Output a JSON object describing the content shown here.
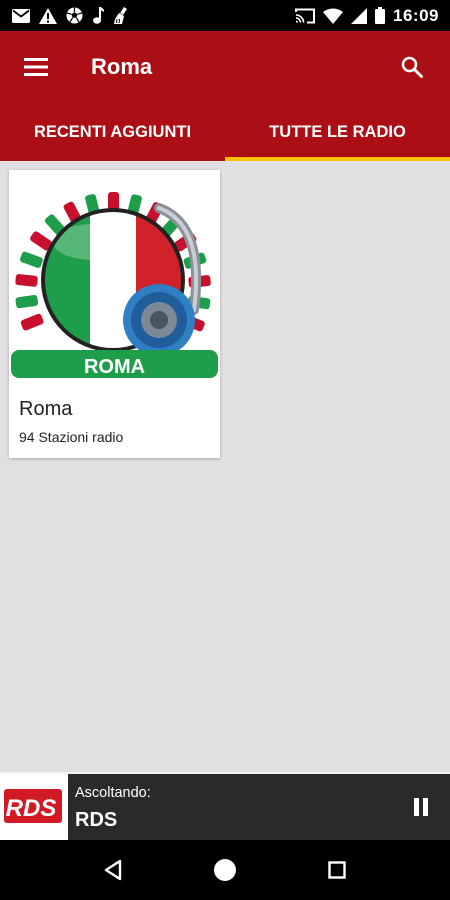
{
  "status_bar": {
    "time": "16:09",
    "left_icons": [
      "mail-icon",
      "warning-icon",
      "soccer-ball-icon",
      "music-note-icon",
      "cleaner-icon"
    ],
    "right_icons": [
      "cast-icon",
      "wifi-icon",
      "signal-icon",
      "battery-icon"
    ]
  },
  "app_bar": {
    "title": "Roma",
    "menu_icon": "menu-icon",
    "search_icon": "search-icon"
  },
  "tabs": [
    {
      "label": "RECENTI AGGIUNTI",
      "active": false
    },
    {
      "label": "TUTTE LE RADIO",
      "active": true
    }
  ],
  "colors": {
    "primary": "#ab0e15",
    "accent": "#ffc107",
    "background": "#e0e0e0",
    "player_bg": "#2a2a2a"
  },
  "cards": [
    {
      "image_text": "ROMA",
      "title": "Roma",
      "subtitle": "94 Stazioni radio"
    }
  ],
  "player": {
    "label": "Ascoltando:",
    "station": "RDS",
    "logo_text": "RDS",
    "control_icon": "pause-icon"
  },
  "nav_bar": {
    "icons": [
      "back-icon",
      "home-icon",
      "recents-icon"
    ]
  }
}
